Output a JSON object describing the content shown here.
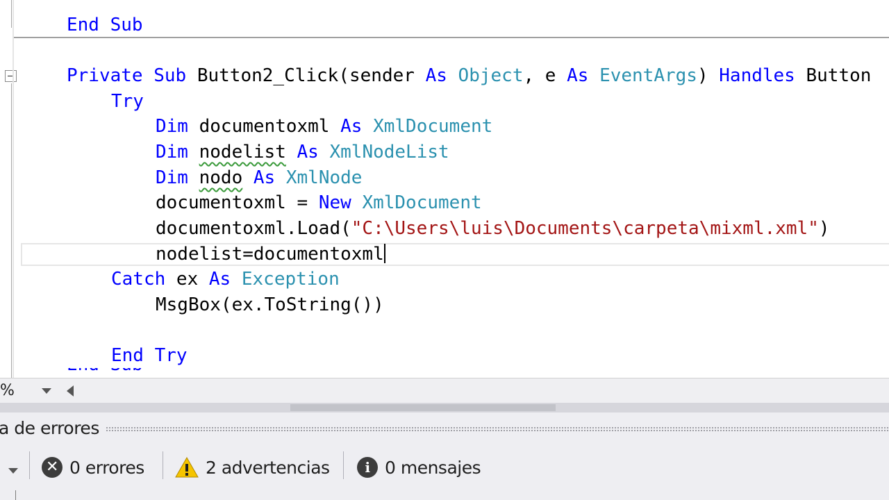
{
  "editor": {
    "lines": [
      [
        {
          "t": "End Sub",
          "c": "kw"
        }
      ],
      [
        {
          "t": "Private Sub ",
          "c": "kw"
        },
        {
          "t": "Button2_Click(sender "
        },
        {
          "t": "As ",
          "c": "kw"
        },
        {
          "t": "Object",
          "c": "ty"
        },
        {
          "t": ", e "
        },
        {
          "t": "As ",
          "c": "kw"
        },
        {
          "t": "EventArgs",
          "c": "ty"
        },
        {
          "t": ") "
        },
        {
          "t": "Handles ",
          "c": "kw"
        },
        {
          "t": "Button"
        }
      ],
      [
        {
          "t": "Try",
          "c": "kw"
        }
      ],
      [
        {
          "t": "Dim ",
          "c": "kw"
        },
        {
          "t": "documentoxml "
        },
        {
          "t": "As ",
          "c": "kw"
        },
        {
          "t": "XmlDocument",
          "c": "ty"
        }
      ],
      [
        {
          "t": "Dim ",
          "c": "kw"
        },
        {
          "t": "nodelist",
          "c": "squig"
        },
        {
          "t": " "
        },
        {
          "t": "As ",
          "c": "kw"
        },
        {
          "t": "XmlNodeList",
          "c": "ty"
        }
      ],
      [
        {
          "t": "Dim ",
          "c": "kw"
        },
        {
          "t": "nodo",
          "c": "squig"
        },
        {
          "t": " "
        },
        {
          "t": "As ",
          "c": "kw"
        },
        {
          "t": "XmlNode",
          "c": "ty"
        }
      ],
      [
        {
          "t": "documentoxml = "
        },
        {
          "t": "New ",
          "c": "kw"
        },
        {
          "t": "XmlDocument",
          "c": "ty"
        }
      ],
      [
        {
          "t": "documentoxml.Load("
        },
        {
          "t": "\"C:\\Users\\luis\\Documents\\carpeta\\mixml.xml\"",
          "c": "str"
        },
        {
          "t": ")"
        }
      ],
      [
        {
          "t": "nodelist=documentoxml"
        }
      ],
      [
        {
          "t": "Catch ",
          "c": "kw"
        },
        {
          "t": "ex "
        },
        {
          "t": "As ",
          "c": "kw"
        },
        {
          "t": "Exception",
          "c": "ty"
        }
      ],
      [
        {
          "t": "MsgBox(ex.ToString())"
        }
      ],
      [
        {
          "t": "End Try",
          "c": "kw"
        }
      ]
    ],
    "partial_line": "End Sub"
  },
  "statusbar": {
    "zoom": "%"
  },
  "error_list": {
    "title": "a de errores",
    "errors_label": "0 errores",
    "warnings_label": "2 advertencias",
    "messages_label": "0 mensajes"
  },
  "icons": [
    "collapse-icon",
    "dropdown-arrow-icon",
    "scroll-left-arrow-icon",
    "error-icon",
    "warning-icon",
    "info-icon"
  ],
  "colors": {
    "keyword": "#0000ff",
    "type": "#2b91af",
    "string": "#a31515",
    "squiggle": "#3a9a3a",
    "warning": "#f5c400"
  }
}
